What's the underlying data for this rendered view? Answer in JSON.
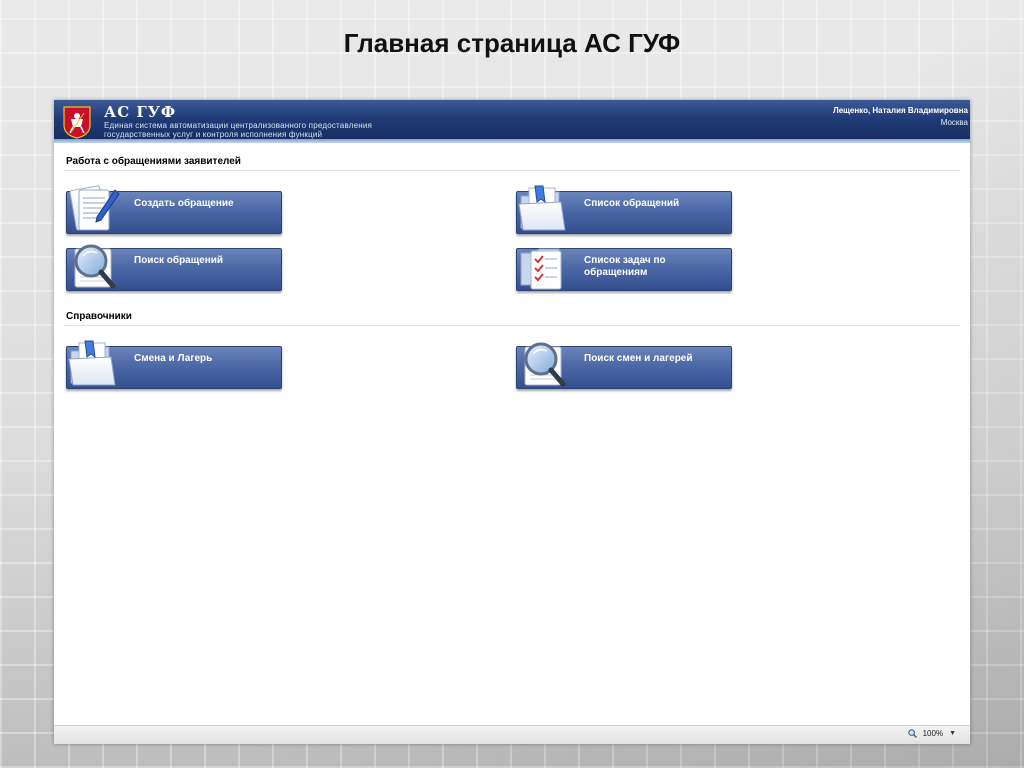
{
  "slide": {
    "title": "Главная страница АС ГУФ"
  },
  "header": {
    "app_name": "АС ГУФ",
    "description": "Единая система автоматизации централизованного предоставления государственных услуг и контроля исполнения функций",
    "user_name": "Лещенко, Наталия Владимировна",
    "user_city": "Москва"
  },
  "sections": [
    {
      "title": "Работа с обращениями заявителей",
      "tiles": [
        {
          "label": "Создать обращение",
          "icon": "document-pen-icon"
        },
        {
          "label": "Список обращений",
          "icon": "folder-icon"
        },
        {
          "label": "Поиск обращений",
          "icon": "magnifier-icon"
        },
        {
          "label": "Список задач по обращениям",
          "icon": "checklist-icon"
        }
      ]
    },
    {
      "title": "Справочники",
      "tiles": [
        {
          "label": "Смена и Лагерь",
          "icon": "folder-icon"
        },
        {
          "label": "Поиск смен и лагерей",
          "icon": "magnifier-icon"
        }
      ]
    }
  ],
  "status_bar": {
    "zoom": "100%"
  },
  "colors": {
    "header_top": "#3c5a95",
    "header_bottom": "#162c5e",
    "tile_top": "#6a85bb",
    "tile_bottom": "#334f8d"
  }
}
